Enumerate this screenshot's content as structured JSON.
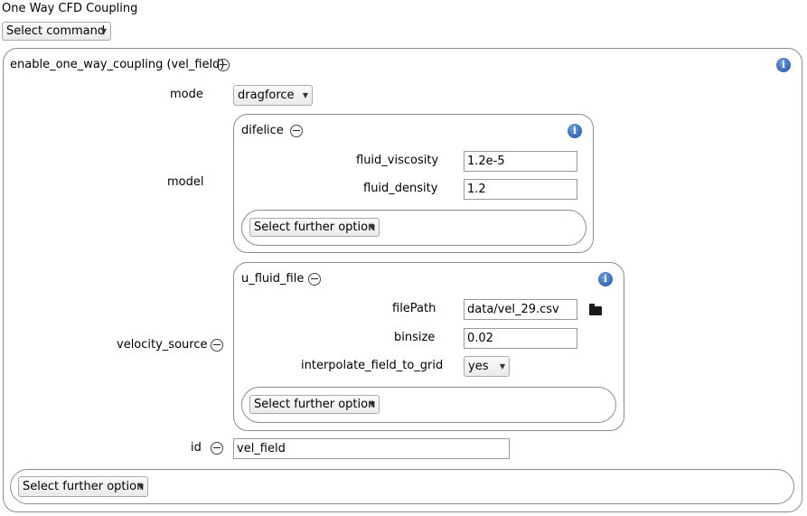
{
  "window": {
    "title": "One Way CFD Coupling"
  },
  "top_command": {
    "label": "Select command"
  },
  "main_panel": {
    "title": "enable_one_way_coupling (vel_field)",
    "mode": {
      "label": "mode",
      "value": "dragforce"
    },
    "model": {
      "label": "model",
      "subpanel": {
        "title": "difelice",
        "fields": [
          {
            "label": "fluid_viscosity",
            "value": "1.2e-5"
          },
          {
            "label": "fluid_density",
            "value": "1.2"
          }
        ],
        "further_option": "Select further option"
      }
    },
    "velocity_source": {
      "label": "velocity_source",
      "subpanel": {
        "title": "u_fluid_file",
        "filepath": {
          "label": "filePath",
          "value": "data/vel_29.csv"
        },
        "binsize": {
          "label": "binsize",
          "value": "0.02"
        },
        "interpolate": {
          "label": "interpolate_field_to_grid",
          "value": "yes"
        },
        "further_option": "Select further option"
      }
    },
    "id": {
      "label": "id",
      "value": "vel_field"
    },
    "further_option": "Select further option"
  },
  "icons": {
    "info": "info-icon",
    "collapse": "minus-circle-icon",
    "folder": "folder-icon",
    "caret": "caret-down-icon"
  },
  "colors": {
    "info_blue": "#1b4fa3",
    "panel_border": "#8c8c8c"
  }
}
